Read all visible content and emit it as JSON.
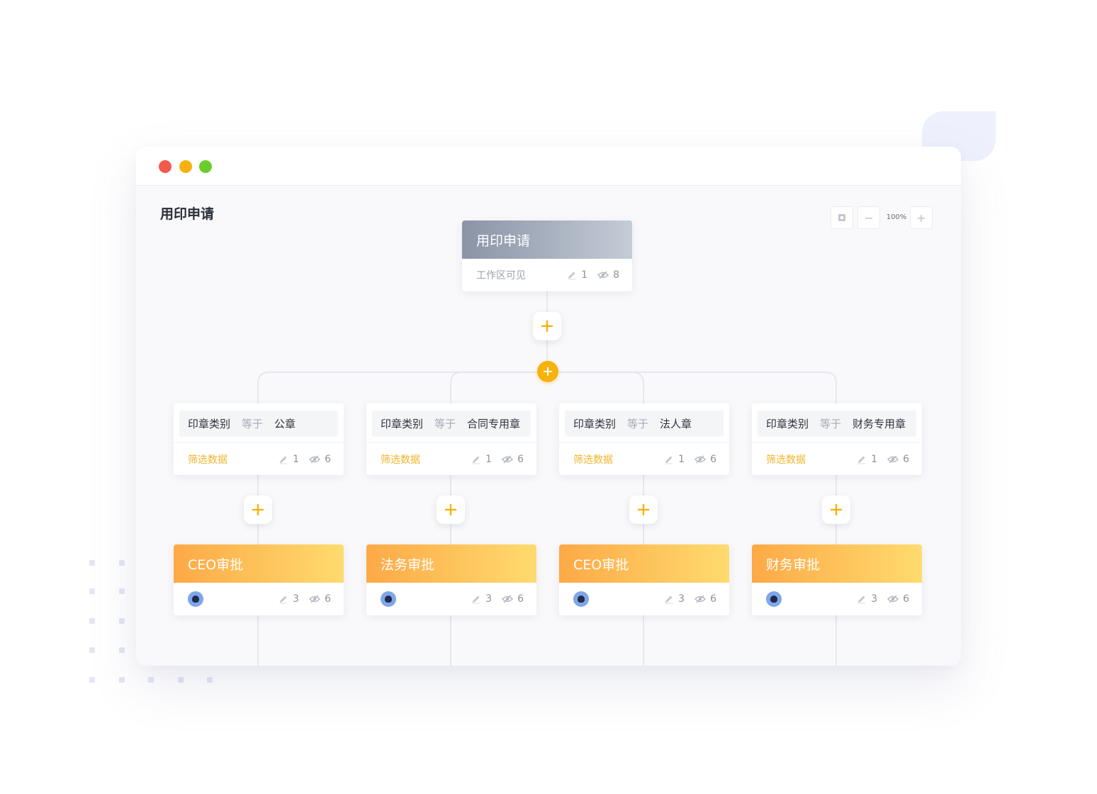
{
  "window": {
    "traffic_lights": [
      "close",
      "minimize",
      "maximize"
    ]
  },
  "page": {
    "title": "用印申请"
  },
  "zoom": {
    "level": "100%",
    "minus_label": "−",
    "plus_label": "+"
  },
  "colors": {
    "accent": "#f7b20f",
    "approval_gradient": [
      "#fda946",
      "#ffdb6f"
    ],
    "start_gradient": [
      "#8a94a6",
      "#c5ccd7"
    ]
  },
  "start_node": {
    "title": "用印申请",
    "scope": "工作区可见",
    "edit_count": "1",
    "view_count": "8"
  },
  "branches": [
    {
      "condition": {
        "field": "印章类别",
        "operator": "等于",
        "value": "公章"
      },
      "filter": {
        "label": "筛选数据",
        "edit_count": "1",
        "view_count": "6"
      },
      "approval": {
        "title": "CEO审批",
        "edit_count": "3",
        "view_count": "6"
      }
    },
    {
      "condition": {
        "field": "印章类别",
        "operator": "等于",
        "value": "合同专用章"
      },
      "filter": {
        "label": "筛选数据",
        "edit_count": "1",
        "view_count": "6"
      },
      "approval": {
        "title": "法务审批",
        "edit_count": "3",
        "view_count": "6"
      }
    },
    {
      "condition": {
        "field": "印章类别",
        "operator": "等于",
        "value": "法人章"
      },
      "filter": {
        "label": "筛选数据",
        "edit_count": "1",
        "view_count": "6"
      },
      "approval": {
        "title": "CEO审批",
        "edit_count": "3",
        "view_count": "6"
      }
    },
    {
      "condition": {
        "field": "印章类别",
        "operator": "等于",
        "value": "财务专用章"
      },
      "filter": {
        "label": "筛选数据",
        "edit_count": "1",
        "view_count": "6"
      },
      "approval": {
        "title": "财务审批",
        "edit_count": "3",
        "view_count": "6"
      }
    }
  ]
}
